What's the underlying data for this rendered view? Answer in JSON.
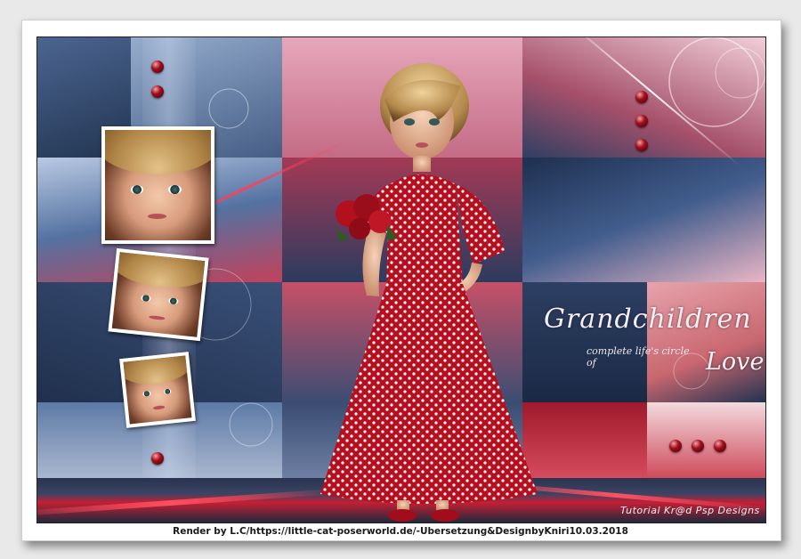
{
  "artwork": {
    "title_main": "Grandchildren",
    "title_sub": "complete life's circle of",
    "title_end": "Love",
    "watermark": "Tutorial Kr@d Psp Designs"
  },
  "credit_line": "Render by L.C/https://little-cat-poserworld.de/-Ubersetzung&DesignbyKniri10.03.2018",
  "palette": {
    "frame": "#ffffff",
    "accent_red": "#b7303f",
    "navy": "#203150",
    "pink": "#d94a58"
  }
}
